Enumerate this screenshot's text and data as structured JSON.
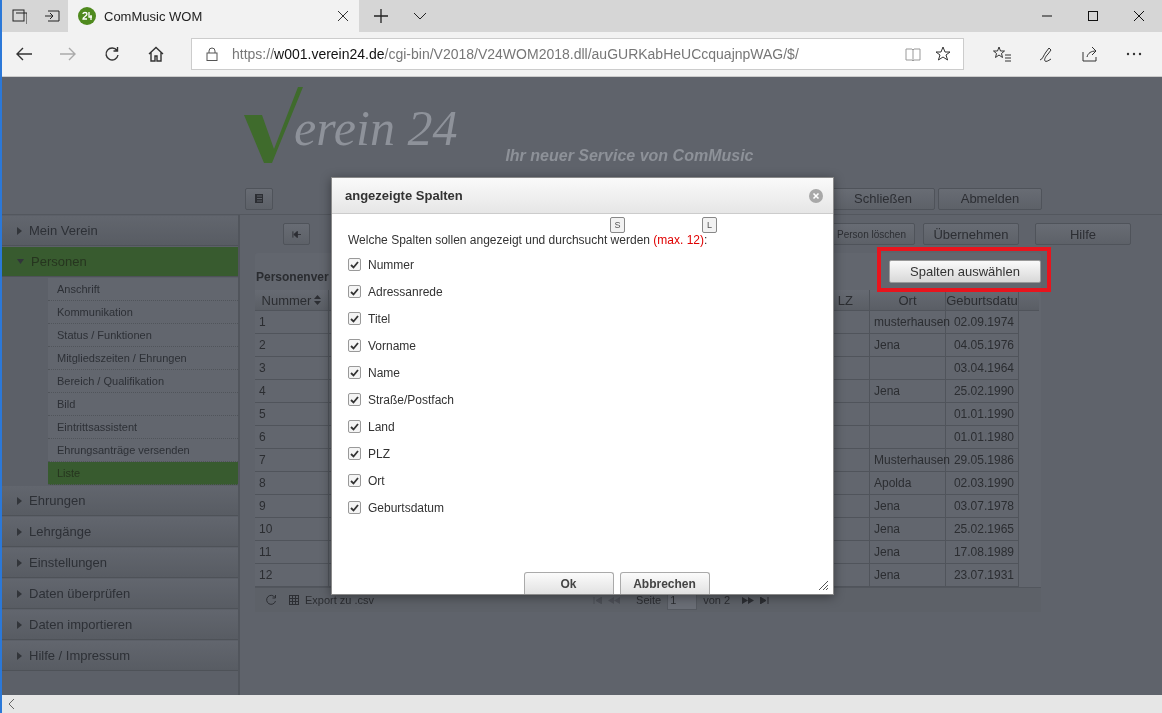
{
  "browser": {
    "tabs": [
      {
        "title": "ComMusic WOM",
        "selected": true
      }
    ],
    "nav": [
      {
        "kind": "back",
        "disabled": false
      },
      {
        "kind": "forward",
        "disabled": true
      },
      {
        "kind": "refresh",
        "disabled": false
      },
      {
        "kind": "home",
        "disabled": false
      }
    ],
    "url": {
      "scheme": "https://",
      "host": "w001.verein24.de",
      "path": "/cgi-bin/V2018/V24WOM2018.dll/auGURKabHeUCcquajnpWAG/$/"
    }
  },
  "app": {
    "logo": {
      "text": "erein 24",
      "tagline": "Ihr neuer Service von ComMusic"
    },
    "top_buttons": [
      "Schließen",
      "Abmelden"
    ],
    "sidebar": [
      {
        "label": "Mein Verein",
        "expanded": false,
        "selected": false
      },
      {
        "label": "Personen",
        "expanded": true,
        "selected": true,
        "children": [
          {
            "label": "Anschrift",
            "selected": false
          },
          {
            "label": "Kommunikation",
            "selected": false
          },
          {
            "label": "Status / Funktionen",
            "selected": false
          },
          {
            "label": "Mitgliedszeiten / Ehrungen",
            "selected": false
          },
          {
            "label": "Bereich / Qualifikation",
            "selected": false
          },
          {
            "label": "Bild",
            "selected": false
          },
          {
            "label": "Eintrittsassistent",
            "selected": false
          },
          {
            "label": "Ehrungsanträge versenden",
            "selected": false
          },
          {
            "label": "Liste",
            "selected": true
          }
        ]
      },
      {
        "label": "Ehrungen",
        "expanded": false,
        "selected": false
      },
      {
        "label": "Lehrgänge",
        "expanded": false,
        "selected": false
      },
      {
        "label": "Einstellungen",
        "expanded": false,
        "selected": false
      },
      {
        "label": "Daten überprüfen",
        "expanded": false,
        "selected": false
      },
      {
        "label": "Daten importieren",
        "expanded": false,
        "selected": false
      },
      {
        "label": "Hilfe / Impressum",
        "expanded": false,
        "selected": false
      }
    ],
    "toolbar": [
      {
        "kind": "first"
      },
      {
        "kind": "delete",
        "label": "Person löschen"
      },
      {
        "kind": "plain",
        "label": "Übernehmen"
      },
      {
        "kind": "plain",
        "label": "Hilfe"
      }
    ],
    "panel": {
      "title": "Personenver",
      "select_columns_button": {
        "label": "Spalten auswählen",
        "highlighted": true
      },
      "columns": [
        {
          "label": "Nummer",
          "sortable": true
        },
        {
          "label": "LZ",
          "sortable": false
        },
        {
          "label": "Ort",
          "sortable": false
        },
        {
          "label": "Geburtsdatu",
          "sortable": false
        }
      ],
      "rows": [
        {
          "nummer": "1",
          "ort": "musterhausen",
          "date": "02.09.1974"
        },
        {
          "nummer": "2",
          "ort": "Jena",
          "date": "04.05.1976"
        },
        {
          "nummer": "3",
          "date": "03.04.1964"
        },
        {
          "nummer": "4",
          "ort": "Jena",
          "date": "25.02.1990"
        },
        {
          "nummer": "5",
          "date": "01.01.1990"
        },
        {
          "nummer": "6",
          "date": "01.01.1980"
        },
        {
          "nummer": "7",
          "ort": "Musterhausen",
          "date": "29.05.1986"
        },
        {
          "nummer": "8",
          "ort": "Apolda",
          "date": "02.03.1990"
        },
        {
          "nummer": "9",
          "ort": "Jena",
          "date": "03.07.1978"
        },
        {
          "nummer": "10",
          "ort": "Jena",
          "date": "25.02.1965"
        },
        {
          "nummer": "11",
          "ort": "Jena",
          "date": "17.08.1989"
        },
        {
          "nummer": "12",
          "ort": "Jena",
          "date": "23.07.1931"
        }
      ],
      "footer": {
        "export": "Export zu .csv",
        "page_label": "Seite",
        "page_value": "1",
        "page_total": "von 2"
      }
    }
  },
  "dialog": {
    "title": "angezeigte Spalten",
    "prompt": {
      "text": "Welche Spalten sollen angezeigt und durchsucht werden ",
      "limit": "(max. 12)",
      "end": ":"
    },
    "options": [
      {
        "label": "Nummer",
        "checked": true
      },
      {
        "label": "Adressanrede",
        "checked": true
      },
      {
        "label": "Titel",
        "checked": true
      },
      {
        "label": "Vorname",
        "checked": true
      },
      {
        "label": "Name",
        "checked": true
      },
      {
        "label": "Straße/Postfach",
        "checked": true
      },
      {
        "label": "Land",
        "checked": true
      },
      {
        "label": "PLZ",
        "checked": true
      },
      {
        "label": "Ort",
        "checked": true
      },
      {
        "label": "Geburtsdatum",
        "checked": true
      }
    ],
    "buttons": [
      "Ok",
      "Abbrechen"
    ],
    "key_hints": [
      "S",
      "L"
    ]
  }
}
